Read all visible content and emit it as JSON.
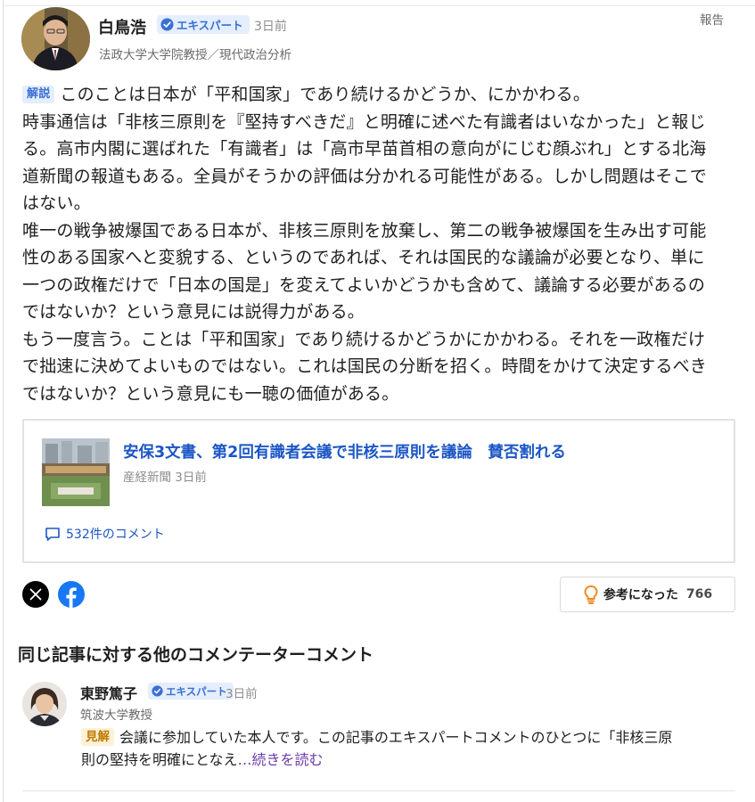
{
  "main_comment": {
    "author_name": "白鳥浩",
    "expert_label": "エキスパート",
    "time_ago": "3日前",
    "author_title": "法政大学大学院教授／現代政治分析",
    "report_label": "報告",
    "tag": "解説",
    "lines": [
      "このことは日本が「平和国家」であり続けるかどうか、にかかわる。",
      "時事通信は「非核三原則を『堅持すべきだ』と明確に述べた有識者はいなかった」と報じ",
      "る。高市内閣に選ばれた「有識者」は「高市早苗首相の意向がにじむ顔ぶれ」とする北海",
      "道新聞の報道もある。全員がそうかの評価は分かれる可能性がある。しかし問題はそこで",
      "はない。",
      "唯一の戦争被爆国である日本が、非核三原則を放棄し、第二の戦争被爆国を生み出す可能",
      "性のある国家へと変貌する、というのであれば、それは国民的な議論が必要となり、単に",
      "一つの政権だけで「日本の国是」を変えてよいかどうかも含めて、議論する必要があるの",
      "ではないか？という意見には説得力がある。",
      "もう一度言う。ことは「平和国家」であり続けるかどうかにかかわる。それを一政権だけ",
      "で拙速に決めてよいものではない。これは国民の分断を招く。時間をかけて決定するべき",
      "ではないか？という意見にも一聴の価値がある。"
    ]
  },
  "article": {
    "title": "安保3文書、第2回有識者会議で非核三原則を議論　賛否割れる",
    "source": "産経新聞",
    "time_ago": "3日前",
    "comment_count": "532件のコメント"
  },
  "share": {
    "x_icon": "x-logo-icon",
    "facebook_icon": "facebook-logo-icon"
  },
  "helpful": {
    "label": "参考になった",
    "count": "766"
  },
  "section_title": "同じ記事に対する他のコメンテーターコメント",
  "second_comment": {
    "author_name": "東野篤子",
    "expert_label": "エキスパート",
    "time_ago": "3日前",
    "author_title": "筑波大学教授",
    "tag": "見解",
    "text_line1": "会議に参加していた本人です。この記事のエキスパートコメントのひとつに「非核三原",
    "text_line2": "則の堅持を明確にとなえ",
    "read_more": "…続きを読む"
  },
  "colors": {
    "link_blue": "#1b56c5",
    "badge_bg": "#e4eefc",
    "badge_text": "#3b6fd4",
    "kenkai_bg": "#fdf1d8",
    "kenkai_text": "#c07a00",
    "read_more": "#6b3ca8",
    "bulb_orange": "#f08a24"
  }
}
